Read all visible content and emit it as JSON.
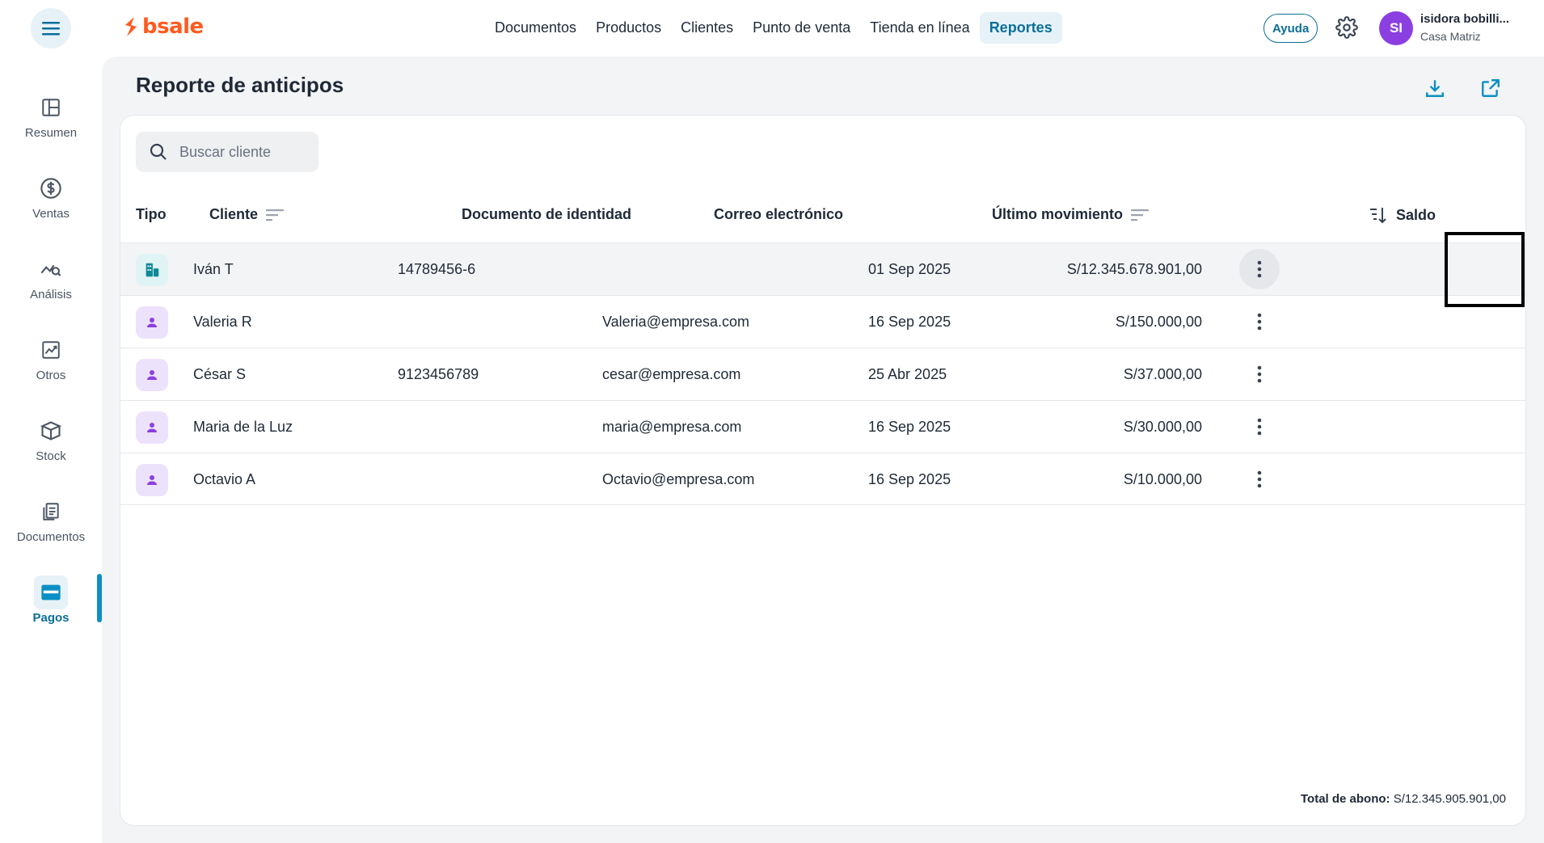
{
  "header": {
    "brand": "bsale",
    "nav": [
      {
        "label": "Documentos",
        "active": false
      },
      {
        "label": "Productos",
        "active": false
      },
      {
        "label": "Clientes",
        "active": false
      },
      {
        "label": "Punto de venta",
        "active": false
      },
      {
        "label": "Tienda en línea",
        "active": false
      },
      {
        "label": "Reportes",
        "active": true
      }
    ],
    "help_label": "Ayuda",
    "user": {
      "initials": "SI",
      "name": "isidora bobilli...",
      "branch": "Casa Matriz"
    }
  },
  "sidebar": {
    "items": [
      {
        "label": "Resumen",
        "icon": "layout-icon"
      },
      {
        "label": "Ventas",
        "icon": "dollar-circle-icon"
      },
      {
        "label": "Análisis",
        "icon": "analytics-icon"
      },
      {
        "label": "Otros",
        "icon": "trend-chart-icon"
      },
      {
        "label": "Stock",
        "icon": "box-icon"
      },
      {
        "label": "Documentos",
        "icon": "documents-icon"
      },
      {
        "label": "Pagos",
        "icon": "card-icon",
        "active": true
      }
    ]
  },
  "page": {
    "title": "Reporte de anticipos",
    "search_placeholder": "Buscar cliente"
  },
  "table": {
    "columns": [
      "Tipo",
      "Cliente",
      "Documento de identidad",
      "Correo electrónico",
      "Último movimiento",
      "Saldo"
    ],
    "rows": [
      {
        "type": "company",
        "client": "Iván T",
        "document": "14789456-6",
        "email": "",
        "last_movement": "01 Sep 2025",
        "balance": "S/12.345.678.901,00"
      },
      {
        "type": "person",
        "client": "Valeria R",
        "document": "",
        "email": "Valeria@empresa.com",
        "last_movement": "16 Sep 2025",
        "balance": "S/150.000,00"
      },
      {
        "type": "person",
        "client": "César S",
        "document": "9123456789",
        "email": "cesar@empresa.com",
        "last_movement": "25 Abr 2025",
        "balance": "S/37.000,00"
      },
      {
        "type": "person",
        "client": "Maria de la Luz",
        "document": "",
        "email": "maria@empresa.com",
        "last_movement": "16 Sep 2025",
        "balance": "S/30.000,00"
      },
      {
        "type": "person",
        "client": "Octavio A",
        "document": "",
        "email": "Octavio@empresa.com",
        "last_movement": "16 Sep 2025",
        "balance": "S/10.000,00"
      }
    ],
    "total_label": "Total de abono:",
    "total_value": "S/12.345.905.901,00"
  },
  "colors": {
    "brand": "#ff5a1f",
    "accent": "#0b6e99",
    "avatar": "#8b3fe0"
  }
}
